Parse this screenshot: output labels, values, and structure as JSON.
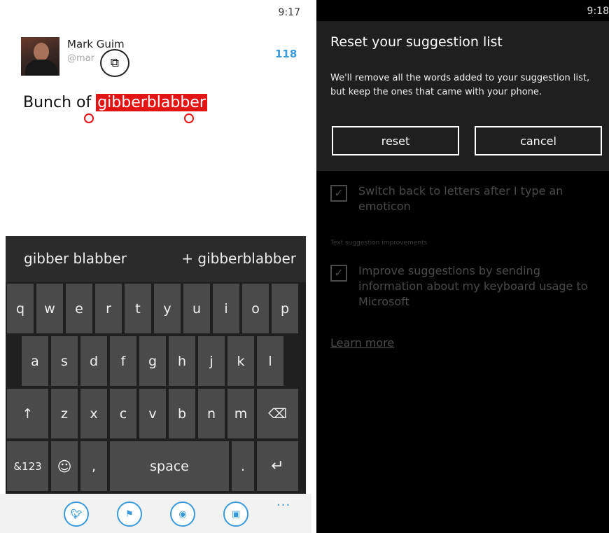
{
  "left": {
    "time": "9:17",
    "author_name": "Mark Guim",
    "author_handle": "@mar",
    "char_count": "118",
    "tweet_prefix": "Bunch of ",
    "tweet_selected": "gibberblabber",
    "icons": {
      "copy": "copy-icon"
    },
    "suggestions": {
      "first": "gibber blabber",
      "second": "+ gibberblabber"
    },
    "keyboard": {
      "row1": [
        "q",
        "w",
        "e",
        "r",
        "t",
        "y",
        "u",
        "i",
        "o",
        "p"
      ],
      "row2": [
        "a",
        "s",
        "d",
        "f",
        "g",
        "h",
        "j",
        "k",
        "l"
      ],
      "row3": [
        "z",
        "x",
        "c",
        "v",
        "b",
        "n",
        "m"
      ],
      "shift": "↑",
      "backspace": "⌫",
      "numbers": "&123",
      "emoji": "☺",
      "comma": ",",
      "space": "space",
      "period": ".",
      "enter": "↵"
    },
    "appbar": {
      "icons": [
        "twitter-icon",
        "foursquare-icon",
        "camera-icon",
        "photo-icon"
      ],
      "more": "..."
    }
  },
  "right": {
    "time": "9:18",
    "dialog": {
      "title": "Reset your suggestion list",
      "body": "We'll remove all the words added to your suggestion list, but keep the ones that came with your phone.",
      "reset_label": "reset",
      "cancel_label": "cancel"
    },
    "options": {
      "switch_back": "Switch back to letters after I type an emoticon",
      "section_label": "Text suggestion improvements",
      "improve": "Improve suggestions by sending information about my keyboard usage to Microsoft"
    },
    "learn_more": "Learn more"
  }
}
